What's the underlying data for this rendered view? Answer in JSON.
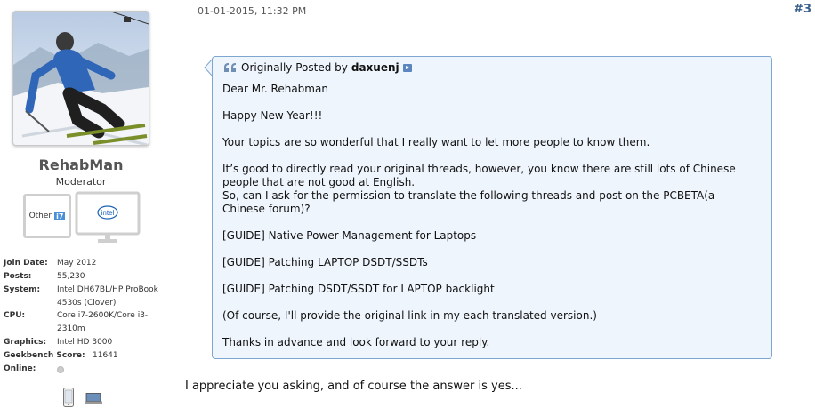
{
  "post": {
    "timestamp": "01-01-2015, 11:32 PM",
    "number": "#3"
  },
  "user": {
    "name": "RehabMan",
    "title": "Moderator",
    "badge_other_label": "Other",
    "badge_other_chip": "i7",
    "badge_intel_label": "intel",
    "info": [
      {
        "label": "Join Date:",
        "value": "May 2012"
      },
      {
        "label": "Posts:",
        "value": "55,230"
      },
      {
        "label": "System:",
        "value": "Intel DH67BL/HP ProBook 4530s (Clover)"
      },
      {
        "label": "CPU:",
        "value": "Core i7-2600K/Core i3-2310m"
      },
      {
        "label": "Graphics:",
        "value": "Intel HD 3000"
      },
      {
        "label": "Geekbench Score:",
        "value": "11641"
      },
      {
        "label": "Online:",
        "value": ""
      }
    ],
    "status_icons": [
      "phone-icon",
      "laptop-icon"
    ]
  },
  "quote": {
    "prefix": "Originally Posted by",
    "author": "daxuenj",
    "lines": [
      "Dear Mr. Rehabman",
      "Happy New Year!!!",
      "Your topics are so wonderful that I really want to let more people to know them.",
      "It’s good to directly read your original threads, however, you know there are still lots of Chinese",
      "people that are not good at English.",
      "So, can I ask for the permission to translate the following threads and post on the PCBETA(a",
      "Chinese forum)?",
      "[GUIDE] Native Power Management for Laptops",
      "[GUIDE] Patching LAPTOP DSDT/SSDTs",
      "[GUIDE] Patching DSDT/SSDT for LAPTOP backlight",
      "(Of course, I'll provide the original link in my each translated version.)",
      "Thanks in advance and look forward to your reply."
    ]
  },
  "reply": "I appreciate you asking, and of course the answer is yes...",
  "colors": {
    "quote_background": "#eff5fd",
    "quote_border": "#7ea7d0",
    "post_number": "#3a5f8c"
  }
}
